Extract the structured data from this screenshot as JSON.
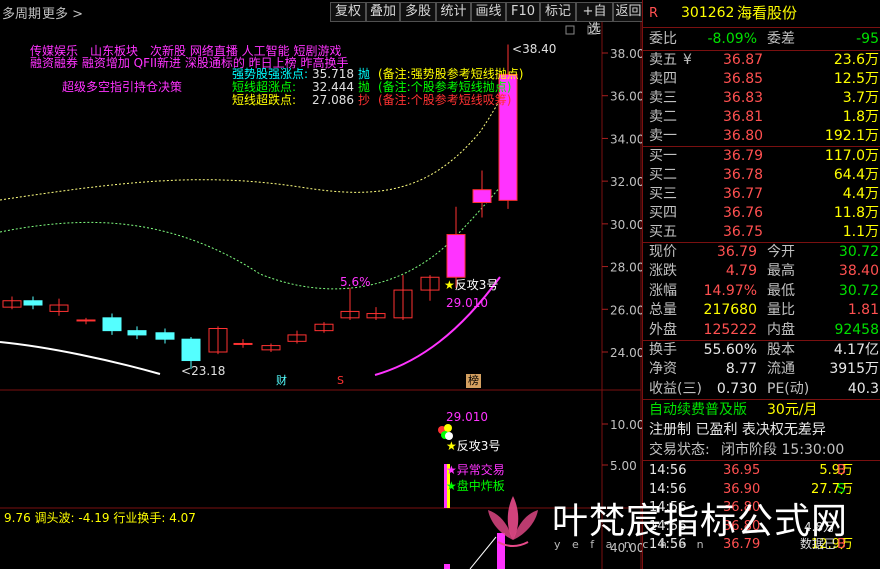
{
  "toolbar": {
    "period_label": "多周期",
    "more_label": "更多",
    "buttons": [
      "复权",
      "叠加",
      "多股",
      "统计",
      "画线",
      "F10",
      "标记",
      "+自选",
      "返回"
    ]
  },
  "chart": {
    "price_axis": [
      "38.00",
      "36.00",
      "34.00",
      "32.00",
      "30.00",
      "28.00",
      "26.00",
      "24.00"
    ],
    "vol_axis": [
      "10.00",
      "5.00"
    ],
    "bottom_axis": "40.00",
    "high_label": "38.40",
    "low_label": "23.18",
    "pct_label": "5.6%",
    "tag_fangong": "反攻3号",
    "tag_price": "29.010",
    "tag_cai": "财",
    "tag_s": "S",
    "tag_bang": "榜",
    "concept_line1": "传媒娱乐　山东板块　次新股 网络直播 人工智能 短剧游戏",
    "concept_line2": "融资融券 融资增加 QFII新进 深股通标的 昨日上榜 昨高换手",
    "strategy_label": "超级多空指引持仓决策",
    "signals": [
      {
        "name": "强势股强涨点:",
        "value": "35.718",
        "flag": "抛",
        "note": "(备注:强势股参考短线抛点)"
      },
      {
        "name": "短线超涨点:",
        "value": "32.444",
        "flag": "抛",
        "note": "(备注:个股参考短线抛点)"
      },
      {
        "name": "短线超跌点:",
        "value": "27.086",
        "flag": "抄",
        "note": "(备注:个股参考短线吸筹)"
      }
    ],
    "sub_price": "29.010",
    "sub_tags": [
      "反攻3号",
      "异常交易",
      "盘中炸板"
    ],
    "indicator_line": {
      "v1": "9.76",
      "label1": "调头波:",
      "v2": "-4.19",
      "label2": "行业换手:",
      "v3": "4.07"
    }
  },
  "quote": {
    "code": "301262",
    "name": "海看股份",
    "r_label": "R",
    "weibi_label": "委比",
    "weibi_value": "-8.09%",
    "weicha_label": "委差",
    "weicha_value": "-95",
    "sells": [
      {
        "label": "卖五",
        "mark": "¥",
        "price": "36.87",
        "vol": "23.6万"
      },
      {
        "label": "卖四",
        "mark": "",
        "price": "36.85",
        "vol": "12.5万"
      },
      {
        "label": "卖三",
        "mark": "",
        "price": "36.83",
        "vol": "3.7万"
      },
      {
        "label": "卖二",
        "mark": "",
        "price": "36.81",
        "vol": "1.8万"
      },
      {
        "label": "卖一",
        "mark": "",
        "price": "36.80",
        "vol": "192.1万"
      }
    ],
    "buys": [
      {
        "label": "买一",
        "price": "36.79",
        "vol": "117.0万"
      },
      {
        "label": "买二",
        "price": "36.78",
        "vol": "64.4万"
      },
      {
        "label": "买三",
        "price": "36.77",
        "vol": "4.4万"
      },
      {
        "label": "买四",
        "price": "36.76",
        "vol": "11.8万"
      },
      {
        "label": "买五",
        "price": "36.75",
        "vol": "1.1万"
      }
    ],
    "stats": [
      {
        "l1": "现价",
        "v1": "36.79",
        "l2": "今开",
        "v2": "30.72",
        "c1": "red",
        "c2": "green"
      },
      {
        "l1": "涨跌",
        "v1": "4.79",
        "l2": "最高",
        "v2": "38.40",
        "c1": "red",
        "c2": "red"
      },
      {
        "l1": "涨幅",
        "v1": "14.97%",
        "l2": "最低",
        "v2": "30.72",
        "c1": "red",
        "c2": "green"
      },
      {
        "l1": "总量",
        "v1": "217680",
        "l2": "量比",
        "v2": "1.81",
        "c1": "yellow",
        "c2": "red"
      },
      {
        "l1": "外盘",
        "v1": "125222",
        "l2": "内盘",
        "v2": "92458",
        "c1": "red",
        "c2": "green"
      }
    ],
    "stats2": [
      {
        "l1": "换手",
        "v1": "55.60%",
        "l2": "股本",
        "v2": "4.17亿"
      },
      {
        "l1": "净资",
        "v1": "8.77",
        "l2": "流通",
        "v2": "3915万"
      },
      {
        "l1": "收益(三)",
        "v1": "0.730",
        "l2": "PE(动)",
        "v2": "40.3"
      }
    ],
    "promo": "自动续费普及版",
    "promo_price": "30元/月",
    "reg_info": "注册制 已盈利 表决权无差异",
    "trade_status_label": "交易状态:",
    "trade_status": "闭市阶段 15:30:00",
    "trades": [
      {
        "time": "14:56",
        "price": "36.95",
        "vol": "5.9万",
        "side": "B"
      },
      {
        "time": "14:56",
        "price": "36.90",
        "vol": "27.7万",
        "side": "S"
      },
      {
        "time": "14:56",
        "price": "36.80",
        "vol": "",
        "side": ""
      },
      {
        "time": "14:56",
        "price": "36.80",
        "vol": "",
        "side": ""
      },
      {
        "time": "14:56",
        "price": "36.79",
        "vol": "12.9万",
        "side": "B"
      }
    ],
    "trade_overlay_1": "4.8万",
    "trade_overlay_2": "数据已"
  },
  "watermark": {
    "text": "叶梵宸指标公式网",
    "sub": "y e f a n c h e n"
  },
  "colors": {
    "up": "#ff3232",
    "down": "#54ffff",
    "magenta": "#ff33ff",
    "yellow": "#ffff00",
    "panel_border": "#7a1010"
  }
}
